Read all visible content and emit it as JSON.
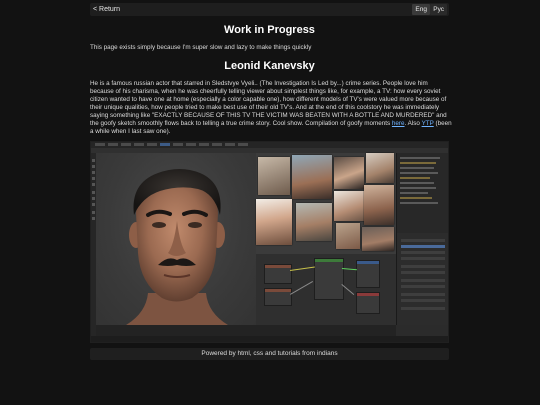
{
  "nav": {
    "back": "< Return",
    "lang_eng": "Eng",
    "lang_rus": "Рус"
  },
  "heading": "Work in Progress",
  "notice": "This page exists simply because I'm super slow and lazy to make things quickly",
  "subheading": "Leonid Kanevsky",
  "description": {
    "text": "He is a famous russian actor that starred in Sledstvye Vyeli.. (The Investigation Is Led by...) crime series. People love him because of his charisma, when he was cheerfully telling viewer about simplest things like, for example, a TV: how every soviet citizen wanted to have one at home (especially a color capable one), how different models of TV's were valued more because of their unique qualities, how people tried to make best use of their old TV's. And at the end of this coolstory he was immediately saying something like \"EXACTLY BECAUSE OF THIS TV THE VICTIM WAS BEATEN WITH A BOTTLE AND MURDERED\" and the goofy sketch smoothly flows back to telling a true crime story. Cool show. Compilation of goofy moments ",
    "link_here": "here",
    "middle": ". Also ",
    "link_ytp": "YTP",
    "tail": " (been a while when I last saw one)."
  },
  "colors": {
    "background": "#121212",
    "link": "#6fb3ff",
    "bar": "#1f1f1f"
  },
  "footer": "Powered by html, css and tutorials from indians"
}
